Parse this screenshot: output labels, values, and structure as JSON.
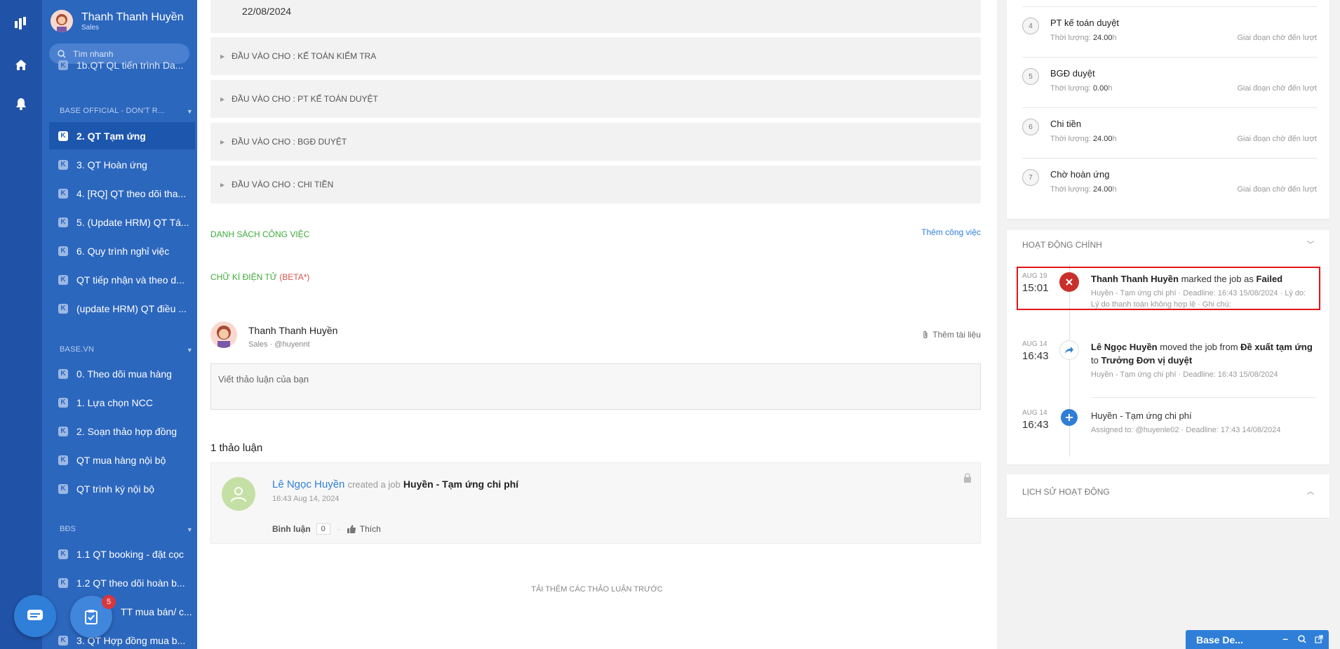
{
  "sidebar": {
    "user_name": "Thanh Thanh Huyền",
    "user_role": "Sales",
    "search_placeholder": "Tìm nhanh",
    "cut_item": "1b.QT QL tiến trình Da...",
    "sections": [
      {
        "title": "BASE OFFICIAL - DON'T R...",
        "items": [
          "2. QT Tạm ứng",
          "3. QT Hoàn ứng",
          "4. [RQ] QT theo dõi tha...",
          "5. (Update HRM) QT Tá...",
          "6. Quy trình nghỉ việc",
          "QT tiếp nhận và theo d...",
          "(update HRM) QT điều ..."
        ]
      },
      {
        "title": "BASE.VN",
        "items": [
          "0. Theo dõi mua hàng",
          "1. Lựa chọn NCC",
          "2. Soạn thảo hợp đồng",
          "QT mua hàng nội bộ",
          "QT trình ký nội bộ"
        ]
      },
      {
        "title": "BĐS",
        "items": [
          "1.1 QT booking - đặt cọc",
          "1.2 QT theo dõi hoàn b...",
          "TT mua bán/ c...",
          "3. QT Hợp đồng mua b..."
        ]
      }
    ],
    "task_badge": "5"
  },
  "main": {
    "date_value": "22/08/2024",
    "input_sections": [
      "ĐẦU VÀO CHO : KẾ TOÁN KIỂM TRA",
      "ĐẦU VÀO CHO : PT KẾ TOÁN DUYỆT",
      "ĐẦU VÀO CHO : BGĐ DUYỆT",
      "ĐẦU VÀO CHO : CHI TIỀN"
    ],
    "tasks_heading": "DANH SÁCH CÔNG VIỆC",
    "add_task": "Thêm công việc",
    "esign_heading": "CHỮ KÍ ĐIỆN TỬ",
    "esign_beta": "(BETA*)",
    "composer": {
      "user_name": "Thanh Thanh Huyền",
      "user_meta": "Sales · @huyennt",
      "attach": "Thêm tài liệu",
      "placeholder": "Viết thảo luận của bạn"
    },
    "discussion_count": "1 thảo luận",
    "discussion": {
      "author": "Lê Ngọc Huyền",
      "verb": "created a job",
      "job": "Huyền - Tạm ứng chi phí",
      "time": "16:43 Aug 14, 2024",
      "comment_label": "Bình luận",
      "comment_count": "0",
      "separator": "·",
      "like_label": "Thích"
    },
    "load_more": "TẢI THÊM CÁC THẢO LUẬN TRƯỚC"
  },
  "right": {
    "duration_label": "Thời lượng:",
    "unit": "h",
    "stage_label": "Giai đoạn chờ đến lượt",
    "steps": [
      {
        "num": "4",
        "name": "PT kế toán duyệt",
        "duration": "24.00"
      },
      {
        "num": "5",
        "name": "BGĐ duyệt",
        "duration": "0.00"
      },
      {
        "num": "6",
        "name": "Chi tiền",
        "duration": "24.00"
      },
      {
        "num": "7",
        "name": "Chờ hoàn ứng",
        "duration": "24.00"
      }
    ],
    "main_activity_title": "HOẠT ĐỘNG CHÍNH",
    "activities": [
      {
        "month": "AUG 19",
        "time": "15:01",
        "actor": "Thanh Thanh Huyền",
        "text": "marked the job as",
        "strong": "Failed",
        "detail": "Huyền - Tạm ứng chi phí · Deadline: 16:43 15/08/2024 · Lý do: Lý do thanh toán không hợp lệ · Ghi chú:"
      },
      {
        "month": "AUG 14",
        "time": "16:43",
        "actor": "Lê Ngọc Huyền",
        "text": "moved the job from",
        "from": "Đề xuất tạm ứng",
        "to_word": "to",
        "to": "Trưởng Đơn vị duyệt",
        "detail": "Huyền - Tạm ứng chi phí · Deadline: 16:43 15/08/2024"
      },
      {
        "month": "AUG 14",
        "time": "16:43",
        "title": "Huyền - Tạm ứng chi phí",
        "detail": "Assigned to: @huyenle02 · Deadline: 17:43 14/08/2024"
      }
    ],
    "history_title": "LỊCH SỬ HOẠT ĐỘNG",
    "mini_window_title": "Base De...",
    "colors": {
      "failed": "#c9302c",
      "primary": "#2f7fd8",
      "highlight": "#e0161b"
    }
  }
}
